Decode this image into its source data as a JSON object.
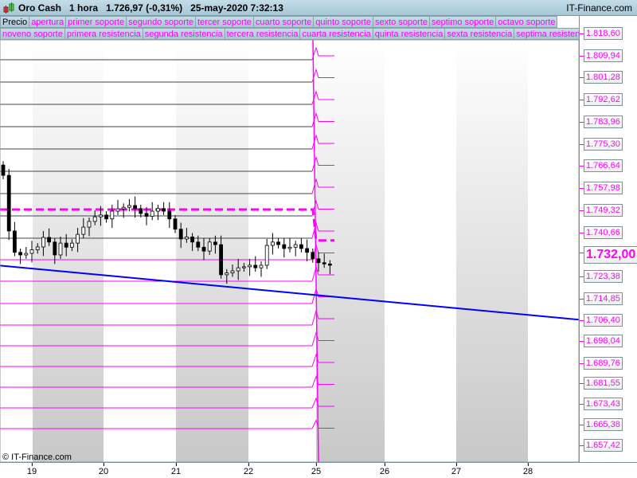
{
  "header": {
    "title": "Oro Cash",
    "timeframe": "1 hora",
    "price": "1.726,97 (-0,31%)",
    "datetime": "25-may-2020 7:32:13",
    "brand": "IT-Finance.com"
  },
  "legend_row1": [
    "Precio",
    "apertura",
    "primer soporte",
    "segundo soporte",
    "tercer soporte",
    "cuarto soporte",
    "quinto soporte",
    "sexto soporte",
    "septimo soporte",
    "octavo soporte"
  ],
  "legend_row2": [
    "noveno soporte",
    "primera resistencia",
    "segunda resistencia",
    "tercera resistencia",
    "cuarta resistencia",
    "quinta resistencia",
    "sexta resistencia",
    "septima resistencia"
  ],
  "price_axis": [
    "1.818,60",
    "1.809,94",
    "1.801,28",
    "1.792,62",
    "1.783,96",
    "1.775,30",
    "1.766,64",
    "1.757,98",
    "1.749,32",
    "1.740,66",
    "1.732,00",
    "1.723,38",
    "1.714,85",
    "1.706,40",
    "1.698,04",
    "1.689,76",
    "1.681,55",
    "1.673,43",
    "1.665,38",
    "1.657,42"
  ],
  "current_price_label": "1.732,00",
  "x_axis": [
    "19",
    "20",
    "21",
    "22",
    "25",
    "26",
    "27",
    "28"
  ],
  "copyright": "© IT-Finance.com",
  "colors": {
    "accent": "#ff00ff",
    "trend": "#0000ff",
    "up": "#ffffff",
    "down": "#000000"
  },
  "chart_data": {
    "type": "candlestick",
    "closes": [
      1762.9,
      1741.3,
      1733,
      1732,
      1732.6,
      1734,
      1735.1,
      1738.8,
      1737,
      1732,
      1736.6,
      1735,
      1736.6,
      1740,
      1742.8,
      1745,
      1746.8,
      1747.5,
      1746,
      1749,
      1749.9,
      1750.5,
      1751.2,
      1750,
      1748.1,
      1747,
      1749,
      1750,
      1749,
      1746,
      1742,
      1738.2,
      1739,
      1737,
      1735,
      1733.5,
      1737,
      1736,
      1724.3,
      1725,
      1725.8,
      1727,
      1727.4,
      1728,
      1727,
      1728,
      1735.7,
      1737,
      1736,
      1734.5,
      1735,
      1736,
      1734.5,
      1733,
      1730.5,
      1729,
      1728.5,
      1728
    ],
    "apertura_old": 1748.1,
    "apertura_new": 1733,
    "trendline": [
      1728.5,
      1707.5
    ]
  }
}
